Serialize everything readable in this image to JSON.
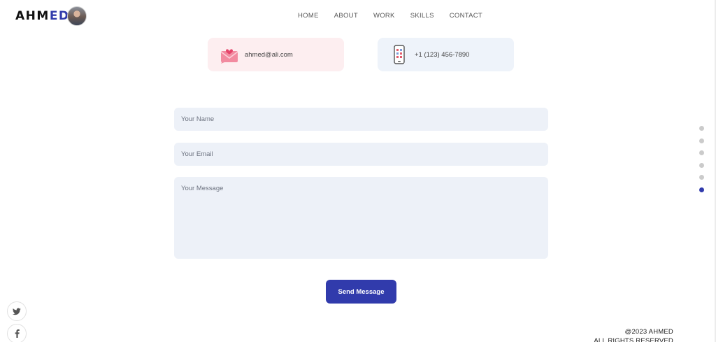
{
  "brand": {
    "logo_prefix": "AHM",
    "logo_accent": "ED"
  },
  "nav": {
    "items": [
      "HOME",
      "ABOUT",
      "WORK",
      "SKILLS",
      "CONTACT"
    ]
  },
  "contact": {
    "email": "ahmed@ali.com",
    "phone": "+1 (123) 456-7890",
    "email_icon": "email-heart-icon",
    "phone_icon": "mobile-phone-icon"
  },
  "form": {
    "name_placeholder": "Your Name",
    "email_placeholder": "Your Email",
    "message_placeholder": "Your Message",
    "submit_label": "Send Message"
  },
  "section_dots": {
    "count": 6,
    "active_index": 5
  },
  "social": {
    "icons": [
      "twitter-icon",
      "facebook-icon"
    ]
  },
  "footer": {
    "copyright": "@2023 AHMED",
    "rights": "ALL RIGHTS RESERVED"
  },
  "colors": {
    "accent": "#313bac",
    "email_card": "#fdeef0",
    "phone_card": "#eef3fa",
    "input_bg": "#edf1f8"
  }
}
